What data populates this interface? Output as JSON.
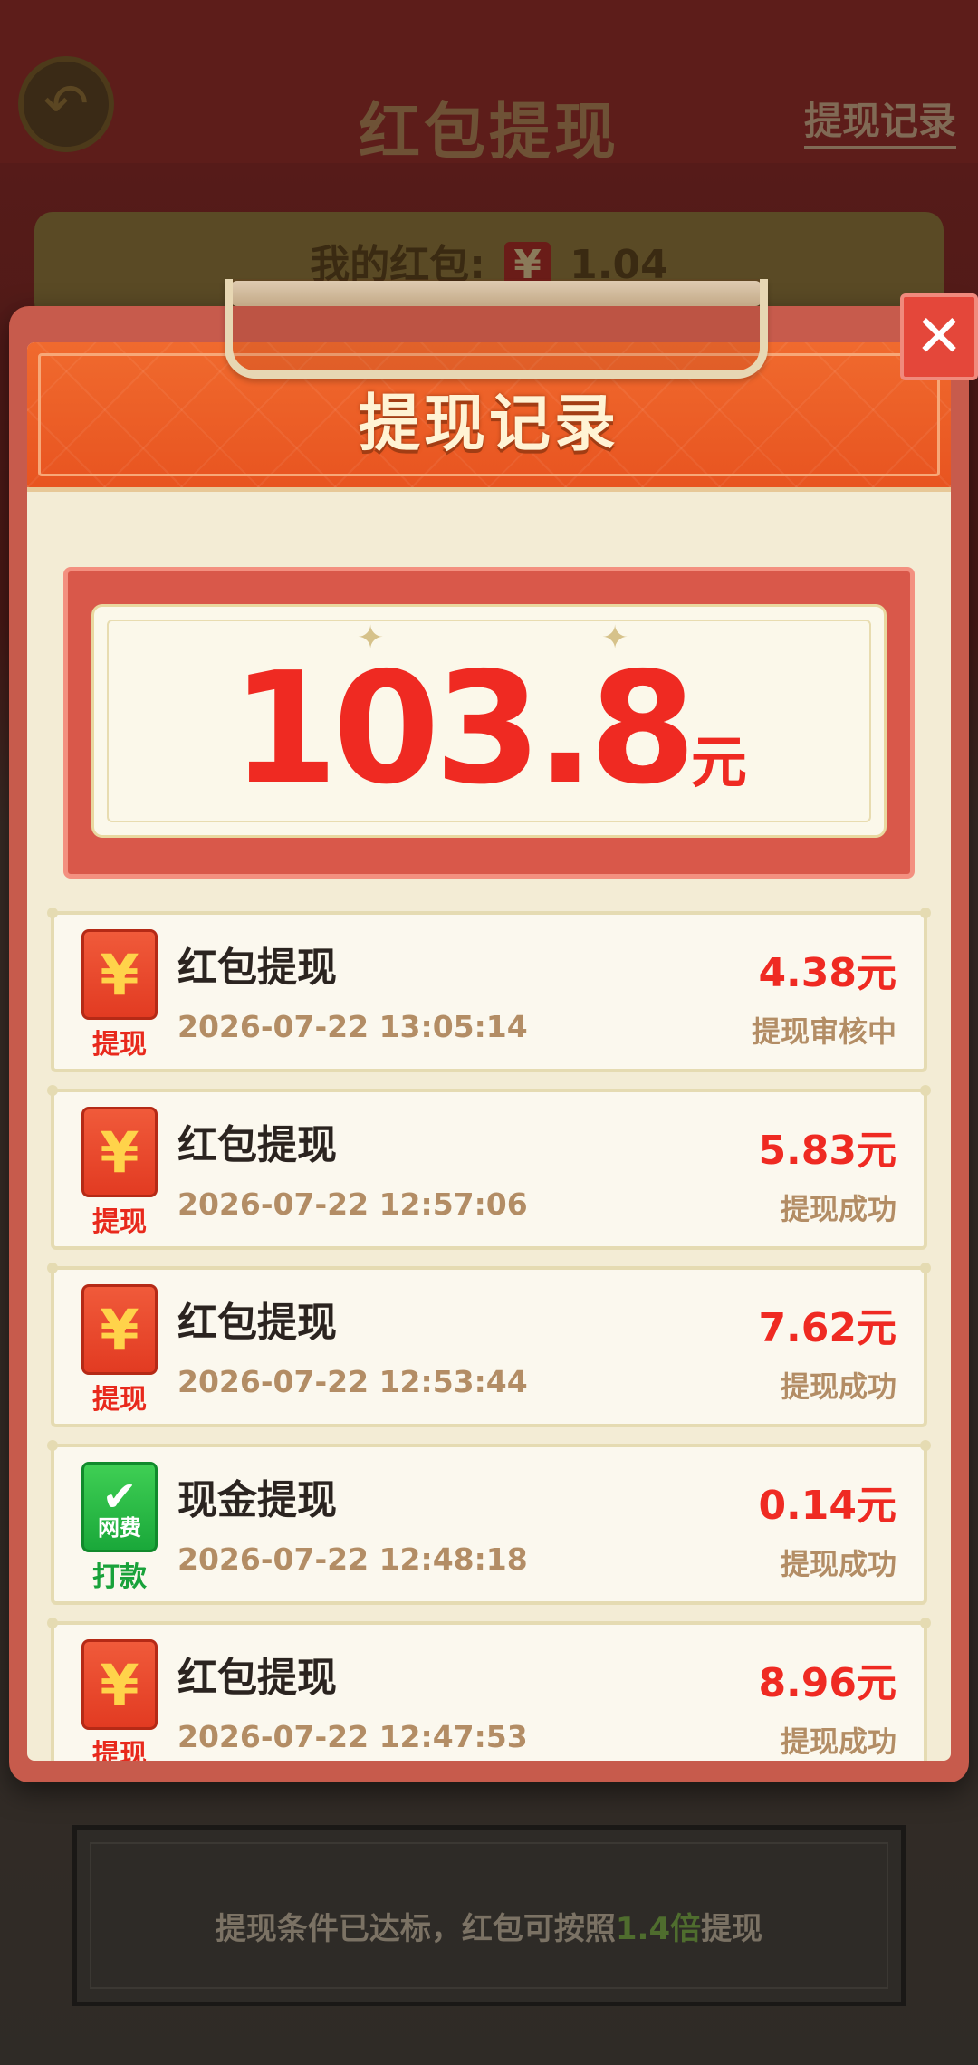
{
  "background": {
    "title": "红包提现",
    "record_link": "提现记录",
    "wallet_label": "我的红包:",
    "wallet_currency": "¥",
    "wallet_amount": "1.04",
    "notice_prefix": "提现条件已达标，红包可按照",
    "notice_highlight": "1.4倍",
    "notice_suffix": "提现"
  },
  "modal": {
    "title": "提现记录",
    "close_symbol": "✕",
    "total_amount": "103.8",
    "total_unit": "元"
  },
  "records": [
    {
      "icon": "yen-icon",
      "icon_glyph": "¥",
      "badge_label": "提现",
      "badge_color": "red",
      "title": "红包提现",
      "time": "2026-07-22 13:05:14",
      "amount": "4.38元",
      "status": "提现审核中"
    },
    {
      "icon": "yen-icon",
      "icon_glyph": "¥",
      "badge_label": "提现",
      "badge_color": "red",
      "title": "红包提现",
      "time": "2026-07-22 12:57:06",
      "amount": "5.83元",
      "status": "提现成功"
    },
    {
      "icon": "yen-icon",
      "icon_glyph": "¥",
      "badge_label": "提现",
      "badge_color": "red",
      "title": "红包提现",
      "time": "2026-07-22 12:53:44",
      "amount": "7.62元",
      "status": "提现成功"
    },
    {
      "icon": "check-icon",
      "icon_glyph": "✔",
      "icon_sub": "网费",
      "badge_label": "打款",
      "badge_color": "green",
      "title": "现金提现",
      "time": "2026-07-22 12:48:18",
      "amount": "0.14元",
      "status": "提现成功"
    },
    {
      "icon": "yen-icon",
      "icon_glyph": "¥",
      "badge_label": "提现",
      "badge_color": "red",
      "title": "红包提现",
      "time": "2026-07-22 12:47:53",
      "amount": "8.96元",
      "status": "提现成功"
    }
  ],
  "colors": {
    "accent_red": "#ef2a22",
    "header_orange": "#e85420",
    "muted_brown": "#b38d65",
    "green": "#18a23a"
  }
}
